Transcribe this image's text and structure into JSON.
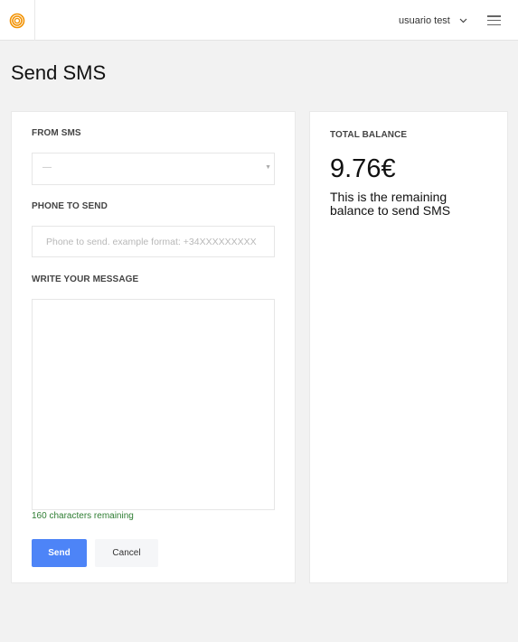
{
  "header": {
    "user_name": "usuario test",
    "brand_color": "#f29100"
  },
  "page": {
    "title": "Send SMS"
  },
  "form": {
    "from_label": "FROM SMS",
    "from_value": "—",
    "phone_label": "PHONE TO SEND",
    "phone_placeholder": "Phone to send. example format: +34XXXXXXXXX",
    "message_label": "WRITE YOUR MESSAGE",
    "chars_remaining": "160 characters remaining",
    "send_label": "Send",
    "cancel_label": "Cancel",
    "accent_color": "#4d84f7",
    "success_color": "#2e7d32"
  },
  "balance": {
    "label": "TOTAL BALANCE",
    "value": "9.76€",
    "description": "This is the remaining balance to send SMS"
  },
  "icons": {
    "logo": "logo-icon",
    "user_menu": "chevron-down-icon",
    "menu": "hamburger-menu-icon",
    "select": "caret-down-icon"
  }
}
